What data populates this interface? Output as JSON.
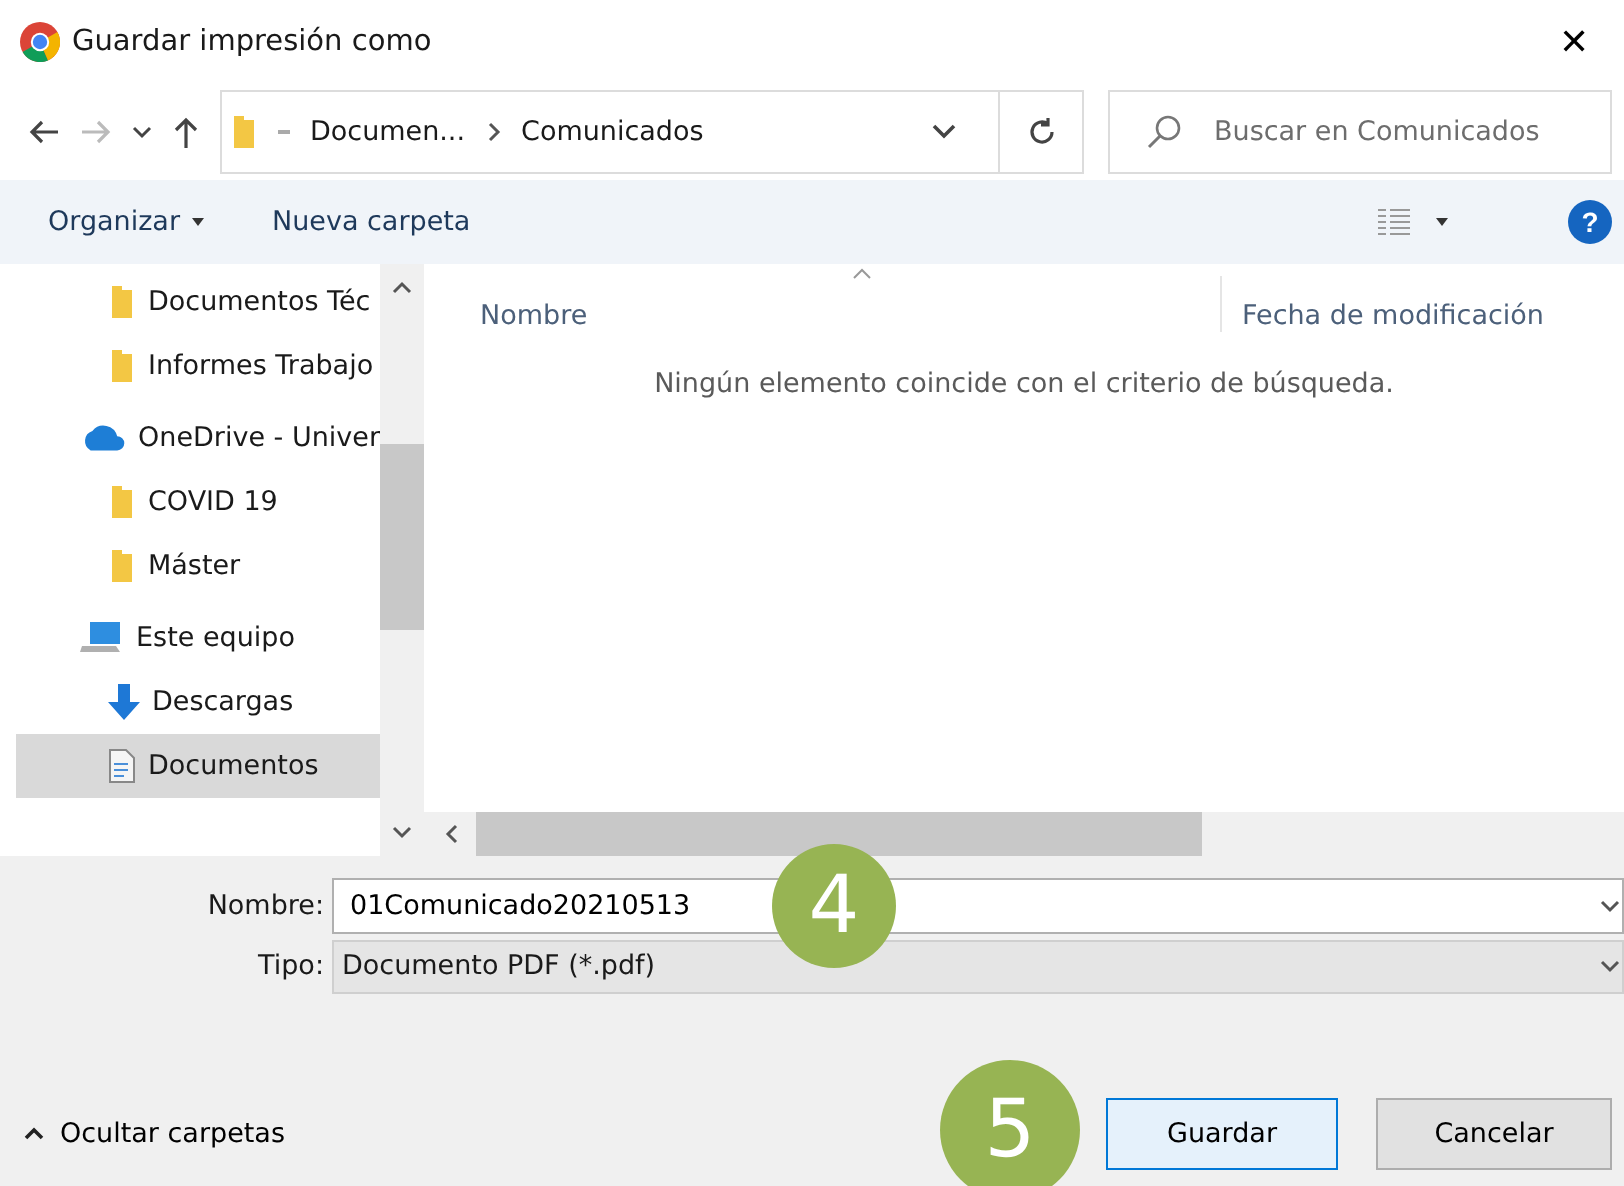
{
  "window": {
    "title": "Guardar impresión como",
    "close": "✕"
  },
  "nav": {
    "path": [
      {
        "label": "Documen..."
      },
      {
        "label": "Comunicados"
      }
    ],
    "search": {
      "placeholder": "Buscar en Comunicados"
    }
  },
  "toolbar": {
    "organize": "Organizar",
    "new_folder": "Nueva carpeta",
    "help": "?"
  },
  "sidebar": {
    "items": [
      {
        "kind": "folder",
        "label": "Documentos Téc",
        "selected": false,
        "indent": true
      },
      {
        "kind": "folder",
        "label": "Informes Trabajo",
        "selected": false,
        "indent": true
      },
      {
        "kind": "cloud",
        "label": "OneDrive - Univer",
        "selected": false,
        "indent": false
      },
      {
        "kind": "folder",
        "label": "COVID 19",
        "selected": false,
        "indent": true
      },
      {
        "kind": "folder",
        "label": "Máster",
        "selected": false,
        "indent": true
      },
      {
        "kind": "pc",
        "label": "Este equipo",
        "selected": false,
        "indent": false
      },
      {
        "kind": "download",
        "label": "Descargas",
        "selected": false,
        "indent": true
      },
      {
        "kind": "document",
        "label": "Documentos",
        "selected": true,
        "indent": true
      }
    ]
  },
  "file_list": {
    "columns": [
      "Nombre",
      "Fecha de modificación"
    ],
    "empty_message": "Ningún elemento coincide con el criterio de búsqueda."
  },
  "form": {
    "name_label": "Nombre:",
    "name_value": "01Comunicado20210513",
    "type_label": "Tipo:",
    "type_value": "Documento PDF (*.pdf)"
  },
  "footer": {
    "hide_folders": "Ocultar carpetas",
    "save": "Guardar",
    "cancel": "Cancelar"
  },
  "step_badges": [
    {
      "label": "4"
    },
    {
      "label": "5"
    }
  ]
}
